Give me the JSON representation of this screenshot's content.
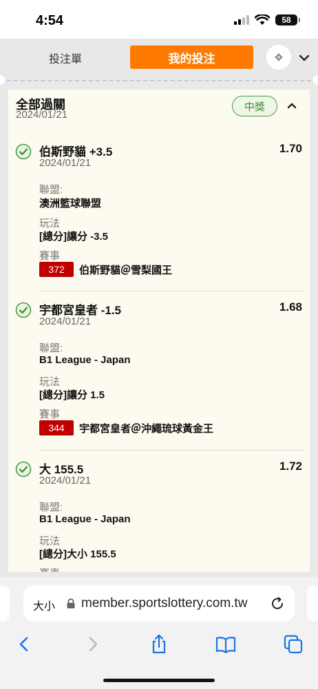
{
  "status_bar": {
    "time": "4:54",
    "battery": "58"
  },
  "header": {
    "tabs": [
      {
        "label": "投注單"
      },
      {
        "label": "我的投注"
      }
    ]
  },
  "parlay": {
    "title": "全部過關",
    "date": "2024/01/21",
    "status": "中獎",
    "legs": [
      {
        "selection": "伯斯野貓 +3.5",
        "odds": "1.70",
        "date": "2024/01/21",
        "league_label": "聯盟:",
        "league": "澳洲籃球聯盟",
        "market_label": "玩法",
        "market": "[總分]讓分 -3.5",
        "event_label": "賽事",
        "event_number": "372",
        "event": "伯斯野貓＠雪梨國王"
      },
      {
        "selection": "宇都宮皇者 -1.5",
        "odds": "1.68",
        "date": "2024/01/21",
        "league_label": "聯盟:",
        "league": "B1 League - Japan",
        "market_label": "玩法",
        "market": "[總分]讓分 1.5",
        "event_label": "賽事",
        "event_number": "344",
        "event": "宇都宮皇者＠沖繩琉球黃金王"
      },
      {
        "selection": "大 155.5",
        "odds": "1.72",
        "date": "2024/01/21",
        "league_label": "聯盟:",
        "league": "B1 League - Japan",
        "market_label": "玩法",
        "market": "[總分]大小 155.5",
        "event_label": "賽事"
      }
    ]
  },
  "browser": {
    "text_size_label": "大小",
    "url": "member.sportslottery.com.tw"
  }
}
